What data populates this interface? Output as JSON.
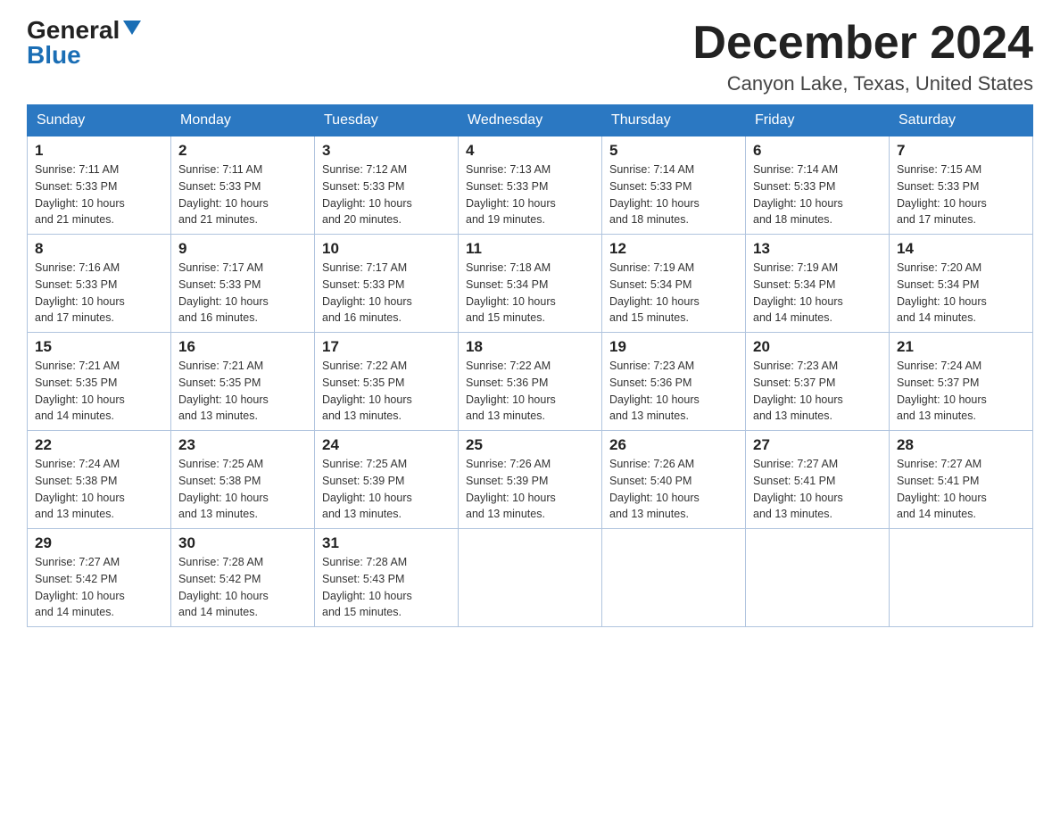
{
  "header": {
    "logo_general": "General",
    "logo_blue": "Blue",
    "month_title": "December 2024",
    "location": "Canyon Lake, Texas, United States"
  },
  "weekdays": [
    "Sunday",
    "Monday",
    "Tuesday",
    "Wednesday",
    "Thursday",
    "Friday",
    "Saturday"
  ],
  "weeks": [
    [
      {
        "day": "1",
        "sunrise": "7:11 AM",
        "sunset": "5:33 PM",
        "daylight": "10 hours and 21 minutes."
      },
      {
        "day": "2",
        "sunrise": "7:11 AM",
        "sunset": "5:33 PM",
        "daylight": "10 hours and 21 minutes."
      },
      {
        "day": "3",
        "sunrise": "7:12 AM",
        "sunset": "5:33 PM",
        "daylight": "10 hours and 20 minutes."
      },
      {
        "day": "4",
        "sunrise": "7:13 AM",
        "sunset": "5:33 PM",
        "daylight": "10 hours and 19 minutes."
      },
      {
        "day": "5",
        "sunrise": "7:14 AM",
        "sunset": "5:33 PM",
        "daylight": "10 hours and 18 minutes."
      },
      {
        "day": "6",
        "sunrise": "7:14 AM",
        "sunset": "5:33 PM",
        "daylight": "10 hours and 18 minutes."
      },
      {
        "day": "7",
        "sunrise": "7:15 AM",
        "sunset": "5:33 PM",
        "daylight": "10 hours and 17 minutes."
      }
    ],
    [
      {
        "day": "8",
        "sunrise": "7:16 AM",
        "sunset": "5:33 PM",
        "daylight": "10 hours and 17 minutes."
      },
      {
        "day": "9",
        "sunrise": "7:17 AM",
        "sunset": "5:33 PM",
        "daylight": "10 hours and 16 minutes."
      },
      {
        "day": "10",
        "sunrise": "7:17 AM",
        "sunset": "5:33 PM",
        "daylight": "10 hours and 16 minutes."
      },
      {
        "day": "11",
        "sunrise": "7:18 AM",
        "sunset": "5:34 PM",
        "daylight": "10 hours and 15 minutes."
      },
      {
        "day": "12",
        "sunrise": "7:19 AM",
        "sunset": "5:34 PM",
        "daylight": "10 hours and 15 minutes."
      },
      {
        "day": "13",
        "sunrise": "7:19 AM",
        "sunset": "5:34 PM",
        "daylight": "10 hours and 14 minutes."
      },
      {
        "day": "14",
        "sunrise": "7:20 AM",
        "sunset": "5:34 PM",
        "daylight": "10 hours and 14 minutes."
      }
    ],
    [
      {
        "day": "15",
        "sunrise": "7:21 AM",
        "sunset": "5:35 PM",
        "daylight": "10 hours and 14 minutes."
      },
      {
        "day": "16",
        "sunrise": "7:21 AM",
        "sunset": "5:35 PM",
        "daylight": "10 hours and 13 minutes."
      },
      {
        "day": "17",
        "sunrise": "7:22 AM",
        "sunset": "5:35 PM",
        "daylight": "10 hours and 13 minutes."
      },
      {
        "day": "18",
        "sunrise": "7:22 AM",
        "sunset": "5:36 PM",
        "daylight": "10 hours and 13 minutes."
      },
      {
        "day": "19",
        "sunrise": "7:23 AM",
        "sunset": "5:36 PM",
        "daylight": "10 hours and 13 minutes."
      },
      {
        "day": "20",
        "sunrise": "7:23 AM",
        "sunset": "5:37 PM",
        "daylight": "10 hours and 13 minutes."
      },
      {
        "day": "21",
        "sunrise": "7:24 AM",
        "sunset": "5:37 PM",
        "daylight": "10 hours and 13 minutes."
      }
    ],
    [
      {
        "day": "22",
        "sunrise": "7:24 AM",
        "sunset": "5:38 PM",
        "daylight": "10 hours and 13 minutes."
      },
      {
        "day": "23",
        "sunrise": "7:25 AM",
        "sunset": "5:38 PM",
        "daylight": "10 hours and 13 minutes."
      },
      {
        "day": "24",
        "sunrise": "7:25 AM",
        "sunset": "5:39 PM",
        "daylight": "10 hours and 13 minutes."
      },
      {
        "day": "25",
        "sunrise": "7:26 AM",
        "sunset": "5:39 PM",
        "daylight": "10 hours and 13 minutes."
      },
      {
        "day": "26",
        "sunrise": "7:26 AM",
        "sunset": "5:40 PM",
        "daylight": "10 hours and 13 minutes."
      },
      {
        "day": "27",
        "sunrise": "7:27 AM",
        "sunset": "5:41 PM",
        "daylight": "10 hours and 13 minutes."
      },
      {
        "day": "28",
        "sunrise": "7:27 AM",
        "sunset": "5:41 PM",
        "daylight": "10 hours and 14 minutes."
      }
    ],
    [
      {
        "day": "29",
        "sunrise": "7:27 AM",
        "sunset": "5:42 PM",
        "daylight": "10 hours and 14 minutes."
      },
      {
        "day": "30",
        "sunrise": "7:28 AM",
        "sunset": "5:42 PM",
        "daylight": "10 hours and 14 minutes."
      },
      {
        "day": "31",
        "sunrise": "7:28 AM",
        "sunset": "5:43 PM",
        "daylight": "10 hours and 15 minutes."
      },
      null,
      null,
      null,
      null
    ]
  ]
}
